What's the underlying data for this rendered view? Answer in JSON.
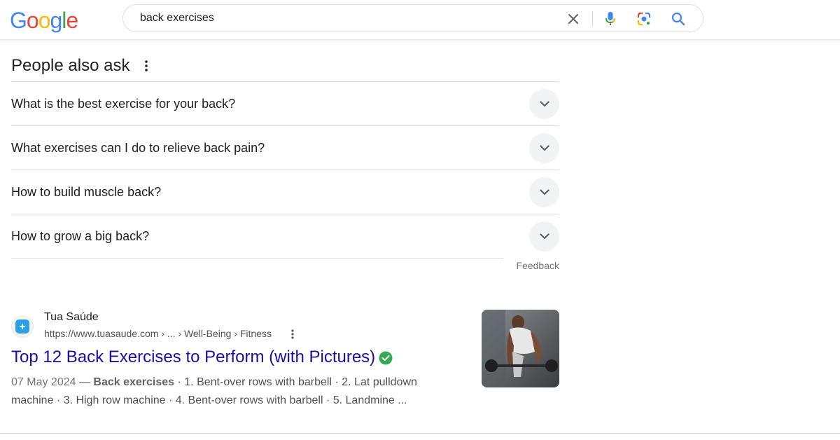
{
  "logo": {
    "letters": [
      "G",
      "o",
      "o",
      "g",
      "l",
      "e"
    ]
  },
  "search": {
    "value": "back exercises",
    "placeholder": ""
  },
  "paa": {
    "title": "People also ask",
    "questions": [
      "What is the best exercise for your back?",
      "What exercises can I do to relieve back pain?",
      "How to build muscle back?",
      "How to grow a big back?"
    ],
    "feedback": "Feedback"
  },
  "result": {
    "site_name": "Tua Saúde",
    "url": "https://www.tuasaude.com › ... › Well-Being › Fitness",
    "title": "Top 12 Back Exercises to Perform (with Pictures)",
    "date": "07 May 2024",
    "snippet_bold": "Back exercises",
    "snippet_rest_line1": " · 1. Bent-over rows with barbell · 2. Lat pulldown",
    "snippet_line2": "machine · 3. High row machine · 4. Bent-over rows with barbell · 5. Landmine ..."
  },
  "colors": {
    "link": "#1a0dab",
    "verified": "#34a853",
    "mic_blue": "#4285F4",
    "mic_red": "#EA4335"
  },
  "icons": {
    "clear": "close-icon",
    "voice": "microphone-icon",
    "lens": "google-lens-icon",
    "search": "search-icon",
    "more": "more-vert-icon",
    "expand": "chevron-down-icon",
    "verified": "verified-check-icon"
  }
}
